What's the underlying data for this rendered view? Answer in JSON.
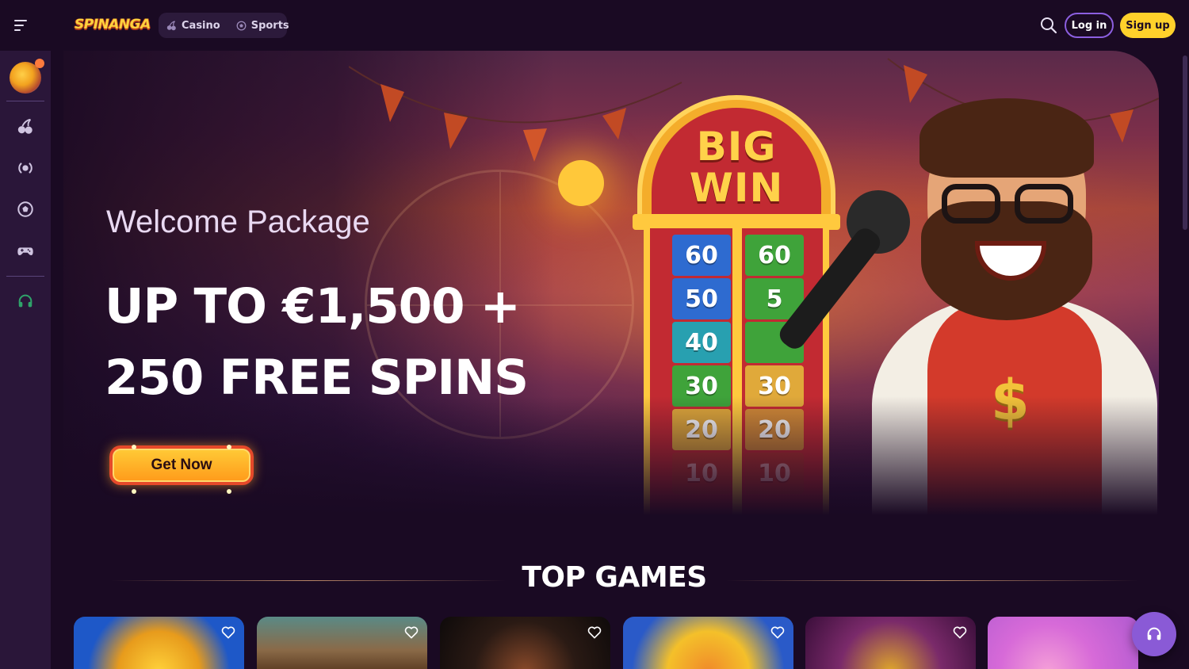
{
  "header": {
    "logo_text": "SPINANGA",
    "tabs": [
      {
        "label": "Casino",
        "icon": "cherries-icon"
      },
      {
        "label": "Sports",
        "icon": "soccer-ball-icon"
      }
    ],
    "login_label": "Log in",
    "signup_label": "Sign up"
  },
  "sidebar": {
    "items": [
      {
        "icon": "cherries-icon"
      },
      {
        "icon": "live-broadcast-icon"
      },
      {
        "icon": "soccer-ball-icon"
      },
      {
        "icon": "gamepad-icon"
      },
      {
        "icon": "headset-icon"
      }
    ]
  },
  "hero": {
    "subtitle": "Welcome Package",
    "title_line1": "UP TO €1,500 +",
    "title_line2": "250 FREE SPINS",
    "cta_label": "Get Now",
    "machine_sign_line1": "BIG",
    "machine_sign_line2": "WIN",
    "machine_left_numbers": [
      "60",
      "50",
      "40",
      "30",
      "20",
      "10"
    ],
    "machine_right_numbers": [
      "60",
      "5",
      "",
      "30",
      "20",
      "10"
    ]
  },
  "top_games": {
    "title": "TOP GAMES",
    "count": 6
  },
  "colors": {
    "background": "#1a0a23",
    "sidebar": "#2a1639",
    "accent_purple": "#8c5fe0",
    "signup_yellow": "#ffd12b",
    "support_purple": "#8a5ad6",
    "support_icon_green": "#2fa36a"
  }
}
